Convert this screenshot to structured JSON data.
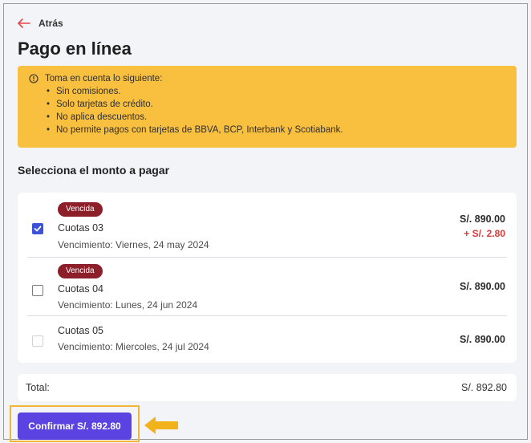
{
  "header": {
    "back_label": "Atrás",
    "title": "Pago en línea"
  },
  "notice": {
    "heading": "Toma en cuenta lo siguiente:",
    "items": [
      "Sin comisiones.",
      "Solo tarjetas de crédito.",
      "No aplica descuentos.",
      "No permite pagos con tarjetas de BBVA, BCP, Interbank y Scotiabank."
    ]
  },
  "section": {
    "title": "Selecciona el monto a pagar"
  },
  "installments": [
    {
      "badge": "Vencida",
      "name": "Cuotas 03",
      "due": "Vencimiento: Viernes, 24 may 2024",
      "amount": "S/. 890.00",
      "extra": "+ S/. 2.80",
      "checked": true
    },
    {
      "badge": "Vencida",
      "name": "Cuotas 04",
      "due": "Vencimiento: Lunes, 24 jun 2024",
      "amount": "S/. 890.00",
      "checked": false
    },
    {
      "name": "Cuotas 05",
      "due": "Vencimiento: Miercoles, 24 jul 2024",
      "amount": "S/. 890.00",
      "checked": false,
      "disabled": true
    }
  ],
  "total": {
    "label": "Total:",
    "value": "S/. 892.80"
  },
  "confirm": {
    "label": "Confirmar S/. 892.80"
  },
  "colors": {
    "accent": "#5a43e0",
    "notice_bg": "#f9bf3f",
    "badge_bg": "#8c1f2a",
    "extra_text": "#d93a3a",
    "highlight": "#f1b53a"
  }
}
